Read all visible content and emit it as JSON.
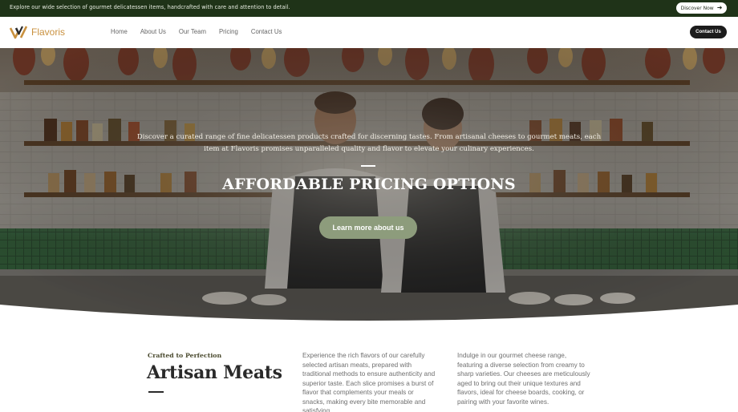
{
  "topbar": {
    "announcement": "Explore our wide selection of gourmet delicatessen items, handcrafted with care and attention to detail.",
    "cta_label": "Discover Now",
    "cta_icon": "arrow-right-icon"
  },
  "navbar": {
    "brand": "Flavoris",
    "links": [
      "Home",
      "About Us",
      "Our Team",
      "Pricing",
      "Contact Us"
    ],
    "contact_label": "Contact Us"
  },
  "hero": {
    "description": "Discover a curated range of fine delicatessen products crafted for discerning tastes. From artisanal cheeses to gourmet meats, each item at Flavoris promises unparalleled quality and flavor to elevate your culinary experiences.",
    "title": "AFFORDABLE PRICING OPTIONS",
    "button_label": "Learn more about us"
  },
  "section": {
    "kicker": "Crafted to Perfection",
    "title": "Artisan Meats",
    "paragraph_1": "Experience the rich flavors of our carefully selected artisan meats, prepared with traditional methods to ensure authenticity and superior taste. Each slice promises a burst of flavor that complements your meals or snacks, making every bite memorable and satisfying.",
    "paragraph_2": "Indulge in our gourmet cheese range, featuring a diverse selection from creamy to sharp varieties. Our cheeses are meticulously aged to bring out their unique textures and flavors, ideal for cheese boards, cooking, or pairing with your favorite wines."
  },
  "colors": {
    "topbar_bg": "#1f3318",
    "brand_accent": "#c9913f",
    "hero_button": "#8d9c7c",
    "dark_button": "#1c1c1c"
  }
}
